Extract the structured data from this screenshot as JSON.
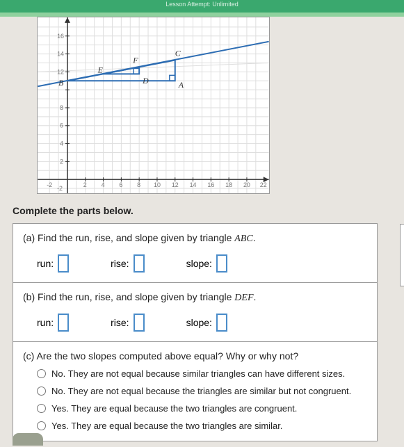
{
  "topbar": {
    "text": "Lesson Attempt: Unlimited"
  },
  "graph": {
    "labels": {
      "A": "A",
      "B": "B",
      "C": "C",
      "D": "D",
      "E": "E",
      "F": "F"
    },
    "yticks": [
      "16",
      "14",
      "12",
      "8",
      "6",
      "4",
      "2",
      "-2"
    ],
    "xticks": [
      "-2",
      "2",
      "4",
      "6",
      "8",
      "10",
      "12",
      "14",
      "16",
      "18",
      "20",
      "22"
    ]
  },
  "instruction": "Complete the parts below.",
  "partA": {
    "prompt_prefix": "(a) Find the run, rise, and slope given by triangle ",
    "prompt_tri": "ABC",
    "prompt_suffix": ".",
    "run": "run:",
    "rise": "rise:",
    "slope": "slope:"
  },
  "partB": {
    "prompt_prefix": "(b) Find the run, rise, and slope given by triangle ",
    "prompt_tri": "DEF",
    "prompt_suffix": ".",
    "run": "run:",
    "rise": "rise:",
    "slope": "slope:"
  },
  "partC": {
    "prompt": "(c) Are the two slopes computed above equal? Why or why not?",
    "opt1": "No. They are not equal because similar triangles can have different sizes.",
    "opt2": "No. They are not equal because the triangles are similar but not congruent.",
    "opt3": "Yes. They are equal because the two triangles are congruent.",
    "opt4": "Yes. They are equal because the two triangles are similar."
  },
  "chart_data": {
    "type": "line",
    "title": "",
    "xlabel": "",
    "ylabel": "",
    "xlim": [
      -2,
      22
    ],
    "ylim": [
      -2,
      16
    ],
    "series": [
      {
        "name": "line",
        "x": [
          -2,
          22
        ],
        "y": [
          10.6,
          15.2
        ]
      }
    ],
    "points": {
      "B": [
        0,
        11
      ],
      "A": [
        12,
        11
      ],
      "C": [
        12,
        13.3
      ],
      "E": [
        4,
        11.77
      ],
      "D": [
        8,
        11.77
      ],
      "F": [
        8,
        12.53
      ]
    },
    "triangles": {
      "ABC": [
        [
          0,
          11
        ],
        [
          12,
          11
        ],
        [
          12,
          13.3
        ]
      ],
      "DEF": [
        [
          4,
          11.77
        ],
        [
          8,
          11.77
        ],
        [
          8,
          12.53
        ]
      ]
    }
  }
}
